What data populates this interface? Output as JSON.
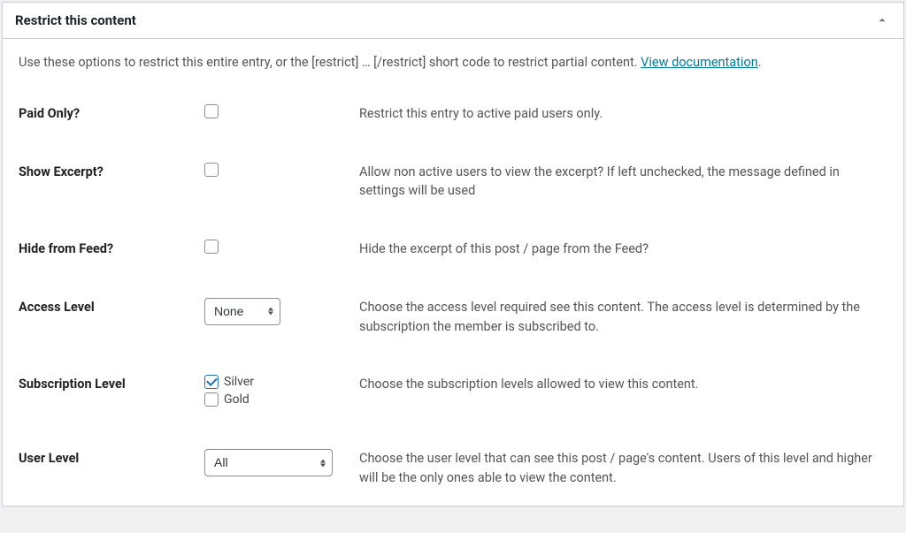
{
  "metabox": {
    "title": "Restrict this content",
    "intro_prefix": "Use these options to restrict this entire entry, or the [restrict] … [/restrict] short code to restrict partial content. ",
    "intro_link": "View documentation",
    "intro_suffix": "."
  },
  "fields": {
    "paid_only": {
      "label": "Paid Only?",
      "description": "Restrict this entry to active paid users only.",
      "checked": false
    },
    "show_excerpt": {
      "label": "Show Excerpt?",
      "description": "Allow non active users to view the excerpt? If left unchecked, the message defined in settings will be used",
      "checked": false
    },
    "hide_from_feed": {
      "label": "Hide from Feed?",
      "description": "Hide the excerpt of this post / page from the Feed?",
      "checked": false
    },
    "access_level": {
      "label": "Access Level",
      "description": "Choose the access level required see this content. The access level is determined by the subscription the member is subscribed to.",
      "selected": "None"
    },
    "subscription_level": {
      "label": "Subscription Level",
      "description": "Choose the subscription levels allowed to view this content.",
      "options": [
        {
          "label": "Silver",
          "checked": true
        },
        {
          "label": "Gold",
          "checked": false
        }
      ]
    },
    "user_level": {
      "label": "User Level",
      "description": "Choose the user level that can see this post / page's content. Users of this level and higher will be the only ones able to view the content.",
      "selected": "All"
    }
  }
}
